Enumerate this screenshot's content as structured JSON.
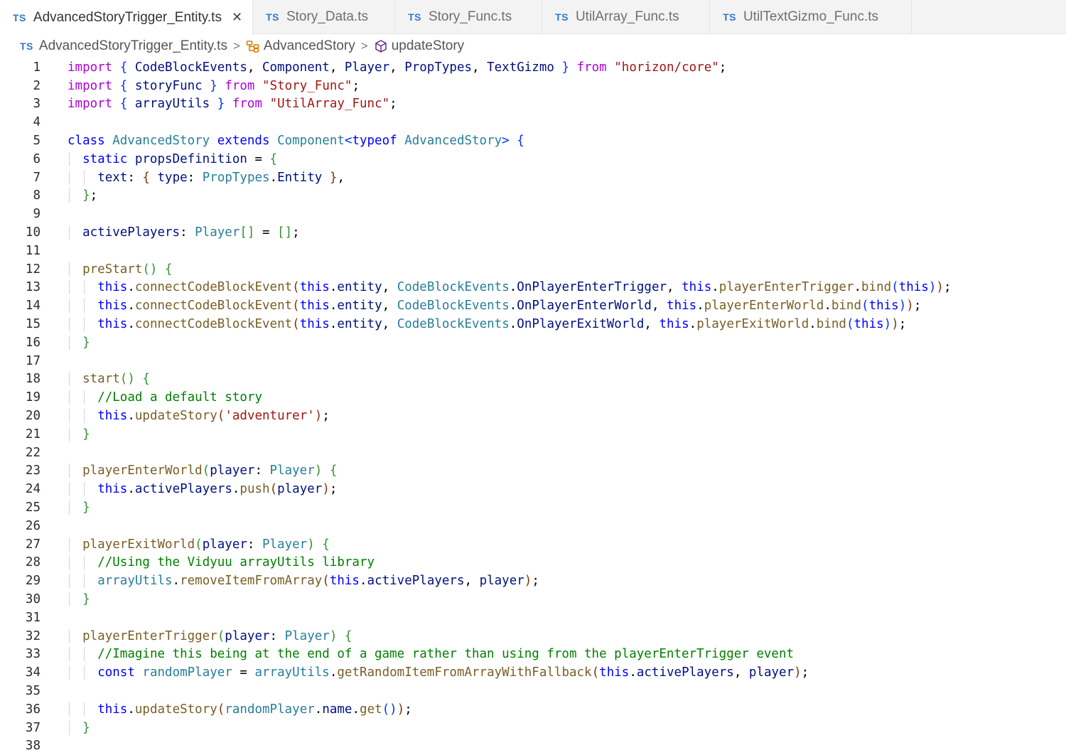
{
  "tabs": [
    {
      "icon": "TS",
      "label": "AdvancedStoryTrigger_Entity.ts",
      "active": true
    },
    {
      "icon": "TS",
      "label": "Story_Data.ts",
      "active": false
    },
    {
      "icon": "TS",
      "label": "Story_Func.ts",
      "active": false
    },
    {
      "icon": "TS",
      "label": "UtilArray_Func.ts",
      "active": false
    },
    {
      "icon": "TS",
      "label": "UtilTextGizmo_Func.ts",
      "active": false
    }
  ],
  "close_glyph": "✕",
  "breadcrumb": {
    "file_icon": "TS",
    "file": "AdvancedStoryTrigger_Entity.ts",
    "class_name": "AdvancedStory",
    "method_name": "updateStory",
    "separator": ">"
  },
  "icons": {
    "class": "class-icon",
    "method": "method-cube-icon",
    "close": "close-icon"
  },
  "colors": {
    "keyword_control": "#af00db",
    "keyword": "#0000ff",
    "type": "#267f99",
    "function": "#795e26",
    "variable": "#001080",
    "string": "#a31515",
    "comment": "#008000",
    "ts_badge": "#3178c6"
  },
  "code_lines": [
    {
      "n": "1",
      "i": 0,
      "t": [
        [
          "kw",
          "import"
        ],
        [
          "pl",
          " "
        ],
        [
          "b1",
          "{"
        ],
        [
          "pl",
          " "
        ],
        [
          "va",
          "CodeBlockEvents"
        ],
        [
          "pl",
          ", "
        ],
        [
          "va",
          "Component"
        ],
        [
          "pl",
          ", "
        ],
        [
          "va",
          "Player"
        ],
        [
          "pl",
          ", "
        ],
        [
          "va",
          "PropTypes"
        ],
        [
          "pl",
          ", "
        ],
        [
          "va",
          "TextGizmo"
        ],
        [
          "pl",
          " "
        ],
        [
          "b1",
          "}"
        ],
        [
          "pl",
          " "
        ],
        [
          "kw",
          "from"
        ],
        [
          "pl",
          " "
        ],
        [
          "st",
          "\"horizon/core\""
        ],
        [
          "pl",
          ";"
        ]
      ]
    },
    {
      "n": "2",
      "i": 0,
      "t": [
        [
          "kw",
          "import"
        ],
        [
          "pl",
          " "
        ],
        [
          "b1",
          "{"
        ],
        [
          "pl",
          " "
        ],
        [
          "va",
          "storyFunc"
        ],
        [
          "pl",
          " "
        ],
        [
          "b1",
          "}"
        ],
        [
          "pl",
          " "
        ],
        [
          "kw",
          "from"
        ],
        [
          "pl",
          " "
        ],
        [
          "st",
          "\"Story_Func\""
        ],
        [
          "pl",
          ";"
        ]
      ]
    },
    {
      "n": "3",
      "i": 0,
      "t": [
        [
          "kw",
          "import"
        ],
        [
          "pl",
          " "
        ],
        [
          "b1",
          "{"
        ],
        [
          "pl",
          " "
        ],
        [
          "va",
          "arrayUtils"
        ],
        [
          "pl",
          " "
        ],
        [
          "b1",
          "}"
        ],
        [
          "pl",
          " "
        ],
        [
          "kw",
          "from"
        ],
        [
          "pl",
          " "
        ],
        [
          "st",
          "\"UtilArray_Func\""
        ],
        [
          "pl",
          ";"
        ]
      ]
    },
    {
      "n": "4",
      "i": 0,
      "t": []
    },
    {
      "n": "5",
      "i": 0,
      "t": [
        [
          "kb",
          "class"
        ],
        [
          "pl",
          " "
        ],
        [
          "ty",
          "AdvancedStory"
        ],
        [
          "pl",
          " "
        ],
        [
          "kb",
          "extends"
        ],
        [
          "pl",
          " "
        ],
        [
          "ty",
          "Component"
        ],
        [
          "b1",
          "<"
        ],
        [
          "kb",
          "typeof"
        ],
        [
          "pl",
          " "
        ],
        [
          "ty",
          "AdvancedStory"
        ],
        [
          "b1",
          ">"
        ],
        [
          "pl",
          " "
        ],
        [
          "b1",
          "{"
        ]
      ]
    },
    {
      "n": "6",
      "i": 1,
      "t": [
        [
          "kb",
          "static"
        ],
        [
          "pl",
          " "
        ],
        [
          "va",
          "propsDefinition"
        ],
        [
          "pl",
          " = "
        ],
        [
          "b2",
          "{"
        ]
      ]
    },
    {
      "n": "7",
      "i": 2,
      "t": [
        [
          "va",
          "text"
        ],
        [
          "pl",
          ": "
        ],
        [
          "b3",
          "{"
        ],
        [
          "pl",
          " "
        ],
        [
          "va",
          "type"
        ],
        [
          "pl",
          ": "
        ],
        [
          "ty",
          "PropTypes"
        ],
        [
          "pl",
          "."
        ],
        [
          "va",
          "Entity"
        ],
        [
          "pl",
          " "
        ],
        [
          "b3",
          "}"
        ],
        [
          "pl",
          ","
        ]
      ]
    },
    {
      "n": "8",
      "i": 1,
      "t": [
        [
          "b2",
          "}"
        ],
        [
          "pl",
          ";"
        ]
      ]
    },
    {
      "n": "9",
      "i": 1,
      "t": []
    },
    {
      "n": "10",
      "i": 1,
      "t": [
        [
          "va",
          "activePlayers"
        ],
        [
          "pl",
          ": "
        ],
        [
          "ty",
          "Player"
        ],
        [
          "b2",
          "[]"
        ],
        [
          "pl",
          " = "
        ],
        [
          "b2",
          "[]"
        ],
        [
          "pl",
          ";"
        ]
      ]
    },
    {
      "n": "11",
      "i": 1,
      "t": []
    },
    {
      "n": "12",
      "i": 1,
      "t": [
        [
          "fn",
          "preStart"
        ],
        [
          "b2",
          "()"
        ],
        [
          "pl",
          " "
        ],
        [
          "b2",
          "{"
        ]
      ]
    },
    {
      "n": "13",
      "i": 2,
      "t": [
        [
          "kb",
          "this"
        ],
        [
          "pl",
          "."
        ],
        [
          "fn",
          "connectCodeBlockEvent"
        ],
        [
          "b3",
          "("
        ],
        [
          "kb",
          "this"
        ],
        [
          "pl",
          "."
        ],
        [
          "va",
          "entity"
        ],
        [
          "pl",
          ", "
        ],
        [
          "ty",
          "CodeBlockEvents"
        ],
        [
          "pl",
          "."
        ],
        [
          "va",
          "OnPlayerEnterTrigger"
        ],
        [
          "pl",
          ", "
        ],
        [
          "kb",
          "this"
        ],
        [
          "pl",
          "."
        ],
        [
          "fn",
          "playerEnterTrigger"
        ],
        [
          "pl",
          "."
        ],
        [
          "fn",
          "bind"
        ],
        [
          "b1",
          "("
        ],
        [
          "kb",
          "this"
        ],
        [
          "b1",
          ")"
        ],
        [
          "b3",
          ")"
        ],
        [
          "pl",
          ";"
        ]
      ]
    },
    {
      "n": "14",
      "i": 2,
      "t": [
        [
          "kb",
          "this"
        ],
        [
          "pl",
          "."
        ],
        [
          "fn",
          "connectCodeBlockEvent"
        ],
        [
          "b3",
          "("
        ],
        [
          "kb",
          "this"
        ],
        [
          "pl",
          "."
        ],
        [
          "va",
          "entity"
        ],
        [
          "pl",
          ", "
        ],
        [
          "ty",
          "CodeBlockEvents"
        ],
        [
          "pl",
          "."
        ],
        [
          "va",
          "OnPlayerEnterWorld"
        ],
        [
          "pl",
          ", "
        ],
        [
          "kb",
          "this"
        ],
        [
          "pl",
          "."
        ],
        [
          "fn",
          "playerEnterWorld"
        ],
        [
          "pl",
          "."
        ],
        [
          "fn",
          "bind"
        ],
        [
          "b1",
          "("
        ],
        [
          "kb",
          "this"
        ],
        [
          "b1",
          ")"
        ],
        [
          "b3",
          ")"
        ],
        [
          "pl",
          ";"
        ]
      ]
    },
    {
      "n": "15",
      "i": 2,
      "t": [
        [
          "kb",
          "this"
        ],
        [
          "pl",
          "."
        ],
        [
          "fn",
          "connectCodeBlockEvent"
        ],
        [
          "b3",
          "("
        ],
        [
          "kb",
          "this"
        ],
        [
          "pl",
          "."
        ],
        [
          "va",
          "entity"
        ],
        [
          "pl",
          ", "
        ],
        [
          "ty",
          "CodeBlockEvents"
        ],
        [
          "pl",
          "."
        ],
        [
          "va",
          "OnPlayerExitWorld"
        ],
        [
          "pl",
          ", "
        ],
        [
          "kb",
          "this"
        ],
        [
          "pl",
          "."
        ],
        [
          "fn",
          "playerExitWorld"
        ],
        [
          "pl",
          "."
        ],
        [
          "fn",
          "bind"
        ],
        [
          "b1",
          "("
        ],
        [
          "kb",
          "this"
        ],
        [
          "b1",
          ")"
        ],
        [
          "b3",
          ")"
        ],
        [
          "pl",
          ";"
        ]
      ]
    },
    {
      "n": "16",
      "i": 1,
      "t": [
        [
          "b2",
          "}"
        ]
      ]
    },
    {
      "n": "17",
      "i": 1,
      "t": []
    },
    {
      "n": "18",
      "i": 1,
      "t": [
        [
          "fn",
          "start"
        ],
        [
          "b2",
          "()"
        ],
        [
          "pl",
          " "
        ],
        [
          "b2",
          "{"
        ]
      ]
    },
    {
      "n": "19",
      "i": 2,
      "t": [
        [
          "cm",
          "//Load a default story"
        ]
      ]
    },
    {
      "n": "20",
      "i": 2,
      "t": [
        [
          "kb",
          "this"
        ],
        [
          "pl",
          "."
        ],
        [
          "fn",
          "updateStory"
        ],
        [
          "b3",
          "("
        ],
        [
          "st",
          "'adventurer'"
        ],
        [
          "b3",
          ")"
        ],
        [
          "pl",
          ";"
        ]
      ]
    },
    {
      "n": "21",
      "i": 1,
      "t": [
        [
          "b2",
          "}"
        ]
      ]
    },
    {
      "n": "22",
      "i": 1,
      "t": []
    },
    {
      "n": "23",
      "i": 1,
      "t": [
        [
          "fn",
          "playerEnterWorld"
        ],
        [
          "b2",
          "("
        ],
        [
          "va",
          "player"
        ],
        [
          "pl",
          ": "
        ],
        [
          "ty",
          "Player"
        ],
        [
          "b2",
          ")"
        ],
        [
          "pl",
          " "
        ],
        [
          "b2",
          "{"
        ]
      ]
    },
    {
      "n": "24",
      "i": 2,
      "t": [
        [
          "kb",
          "this"
        ],
        [
          "pl",
          "."
        ],
        [
          "va",
          "activePlayers"
        ],
        [
          "pl",
          "."
        ],
        [
          "fn",
          "push"
        ],
        [
          "b3",
          "("
        ],
        [
          "va",
          "player"
        ],
        [
          "b3",
          ")"
        ],
        [
          "pl",
          ";"
        ]
      ]
    },
    {
      "n": "25",
      "i": 1,
      "t": [
        [
          "b2",
          "}"
        ]
      ]
    },
    {
      "n": "26",
      "i": 1,
      "t": []
    },
    {
      "n": "27",
      "i": 1,
      "t": [
        [
          "fn",
          "playerExitWorld"
        ],
        [
          "b2",
          "("
        ],
        [
          "va",
          "player"
        ],
        [
          "pl",
          ": "
        ],
        [
          "ty",
          "Player"
        ],
        [
          "b2",
          ")"
        ],
        [
          "pl",
          " "
        ],
        [
          "b2",
          "{"
        ]
      ]
    },
    {
      "n": "28",
      "i": 2,
      "t": [
        [
          "cm",
          "//Using the Vidyuu arrayUtils library"
        ]
      ]
    },
    {
      "n": "29",
      "i": 2,
      "t": [
        [
          "ty",
          "arrayUtils"
        ],
        [
          "pl",
          "."
        ],
        [
          "fn",
          "removeItemFromArray"
        ],
        [
          "b3",
          "("
        ],
        [
          "kb",
          "this"
        ],
        [
          "pl",
          "."
        ],
        [
          "va",
          "activePlayers"
        ],
        [
          "pl",
          ", "
        ],
        [
          "va",
          "player"
        ],
        [
          "b3",
          ")"
        ],
        [
          "pl",
          ";"
        ]
      ]
    },
    {
      "n": "30",
      "i": 1,
      "t": [
        [
          "b2",
          "}"
        ]
      ]
    },
    {
      "n": "31",
      "i": 1,
      "t": []
    },
    {
      "n": "32",
      "i": 1,
      "t": [
        [
          "fn",
          "playerEnterTrigger"
        ],
        [
          "b2",
          "("
        ],
        [
          "va",
          "player"
        ],
        [
          "pl",
          ": "
        ],
        [
          "ty",
          "Player"
        ],
        [
          "b2",
          ")"
        ],
        [
          "pl",
          " "
        ],
        [
          "b2",
          "{"
        ]
      ]
    },
    {
      "n": "33",
      "i": 2,
      "t": [
        [
          "cm",
          "//Imagine this being at the end of a game rather than using from the playerEnterTrigger event"
        ]
      ]
    },
    {
      "n": "34",
      "i": 2,
      "t": [
        [
          "kb",
          "const"
        ],
        [
          "pl",
          " "
        ],
        [
          "ty",
          "randomPlayer"
        ],
        [
          "pl",
          " = "
        ],
        [
          "ty",
          "arrayUtils"
        ],
        [
          "pl",
          "."
        ],
        [
          "fn",
          "getRandomItemFromArrayWithFallback"
        ],
        [
          "b3",
          "("
        ],
        [
          "kb",
          "this"
        ],
        [
          "pl",
          "."
        ],
        [
          "va",
          "activePlayers"
        ],
        [
          "pl",
          ", "
        ],
        [
          "va",
          "player"
        ],
        [
          "b3",
          ")"
        ],
        [
          "pl",
          ";"
        ]
      ]
    },
    {
      "n": "35",
      "i": 2,
      "t": []
    },
    {
      "n": "36",
      "i": 2,
      "t": [
        [
          "kb",
          "this"
        ],
        [
          "pl",
          "."
        ],
        [
          "fn",
          "updateStory"
        ],
        [
          "b3",
          "("
        ],
        [
          "ty",
          "randomPlayer"
        ],
        [
          "pl",
          "."
        ],
        [
          "va",
          "name"
        ],
        [
          "pl",
          "."
        ],
        [
          "fn",
          "get"
        ],
        [
          "b1",
          "()"
        ],
        [
          "b3",
          ")"
        ],
        [
          "pl",
          ";"
        ]
      ]
    },
    {
      "n": "37",
      "i": 1,
      "t": [
        [
          "b2",
          "}"
        ]
      ]
    },
    {
      "n": "38",
      "i": 1,
      "t": []
    }
  ]
}
